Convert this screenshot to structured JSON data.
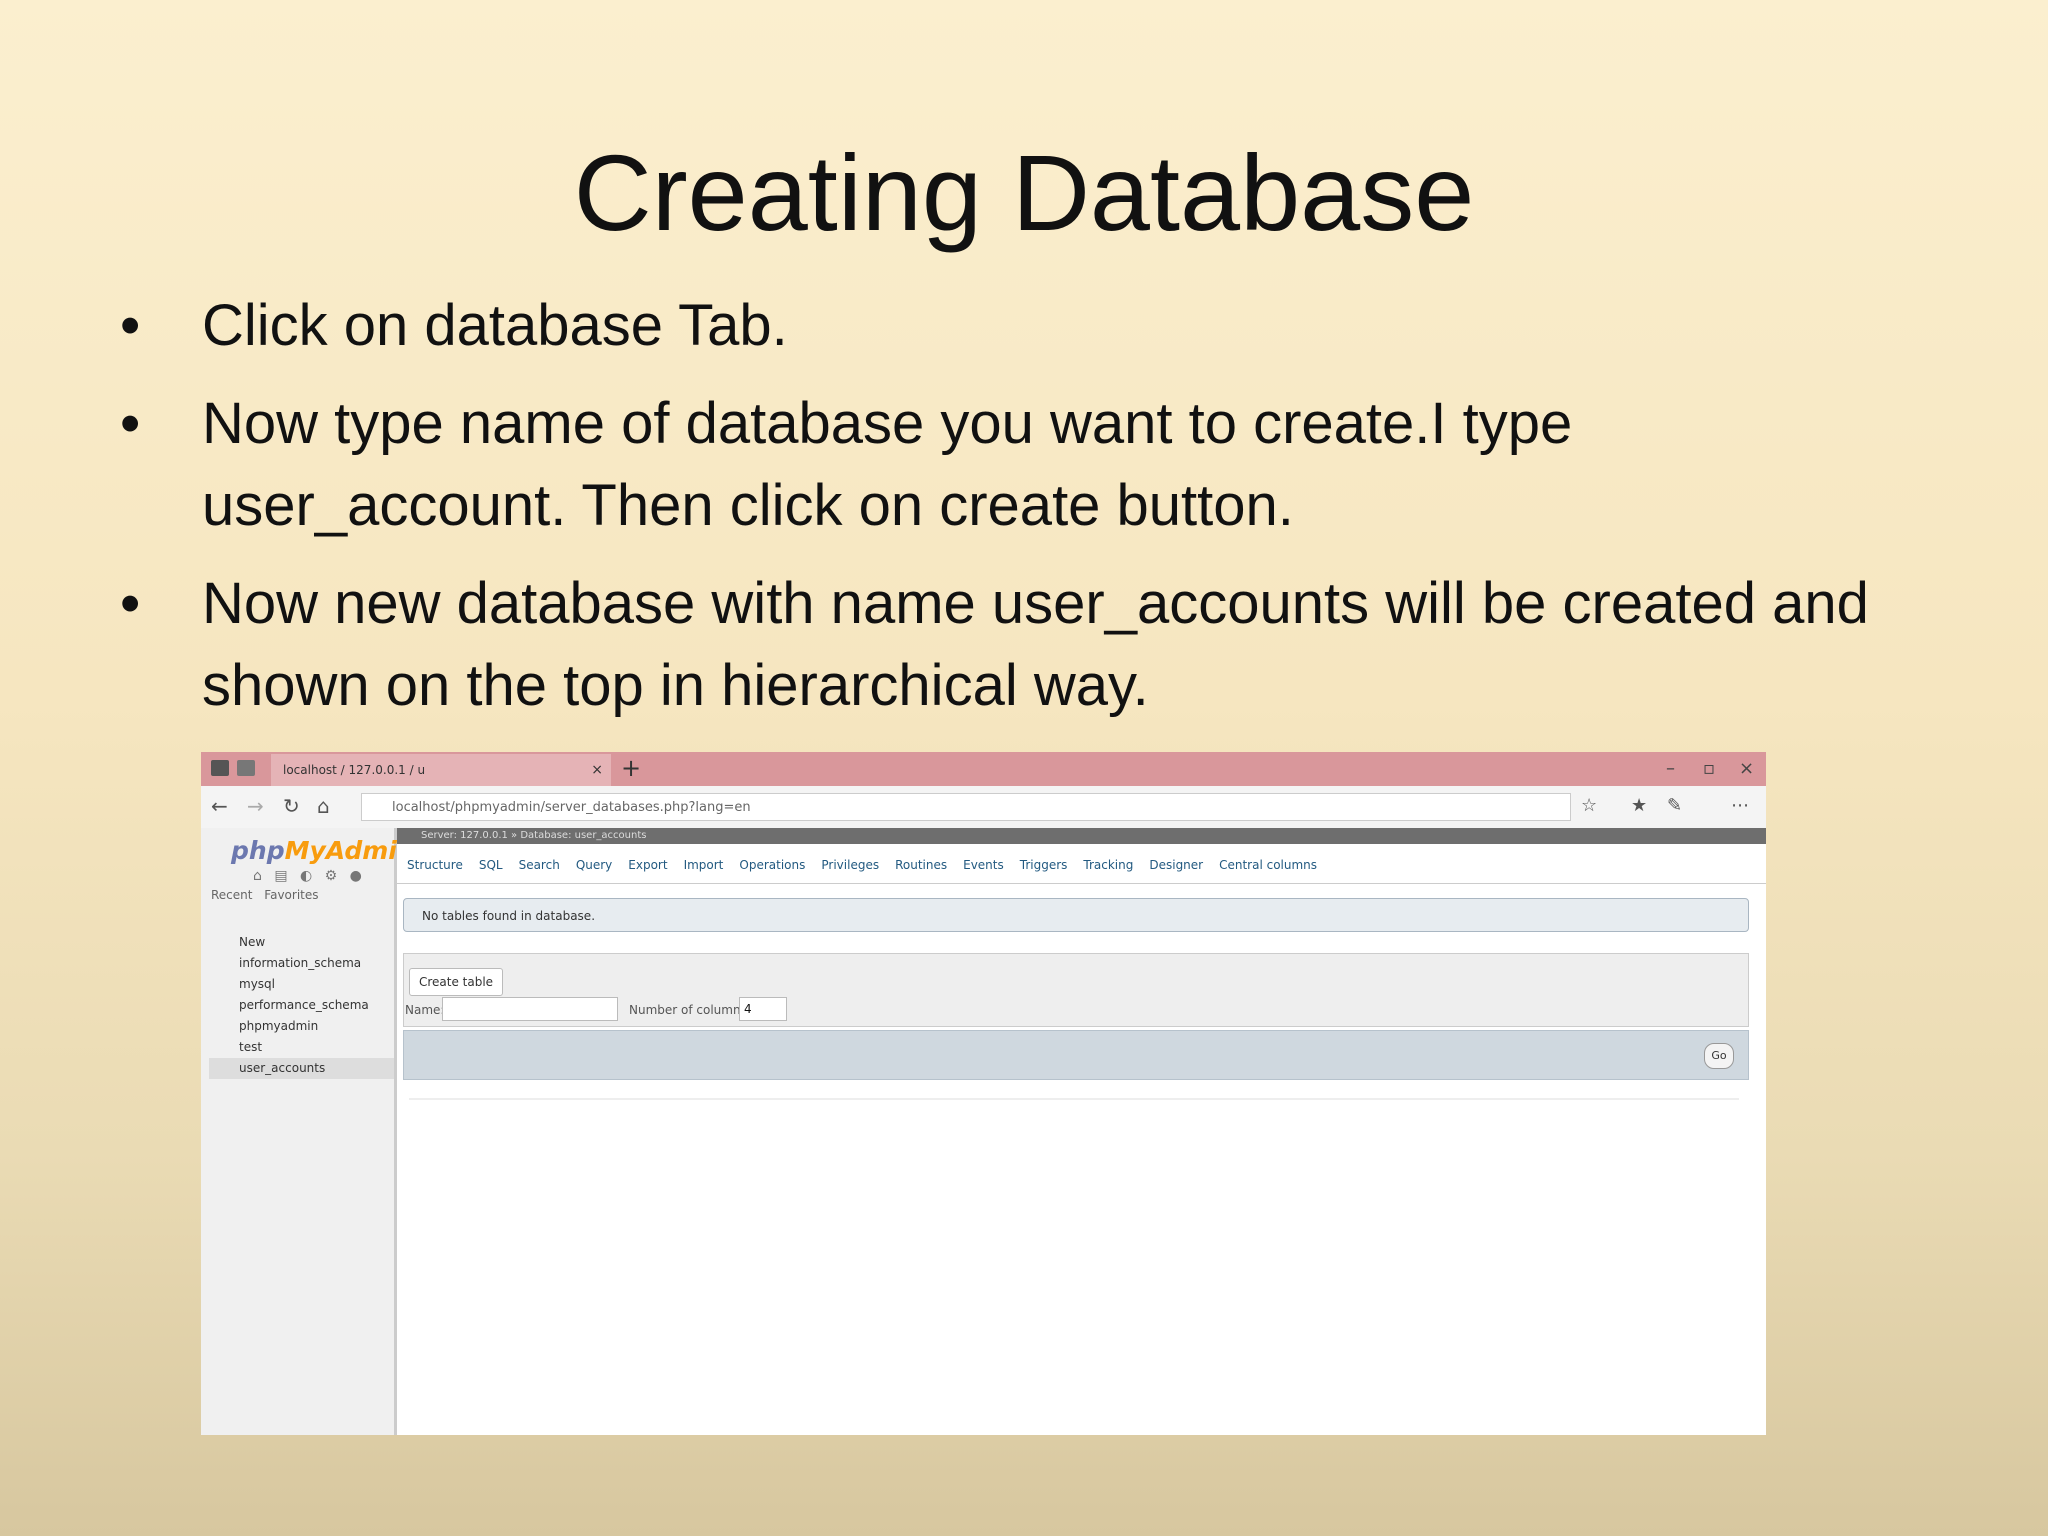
{
  "slide": {
    "title": "Creating Database",
    "bullet_glyph": "•",
    "bullets": [
      "Click on database Tab.",
      "Now type name of database you want to create.I type user_account. Then click on create button.",
      "Now new database with name user_accounts will be created and shown on the top in hierarchical way."
    ]
  },
  "screenshot": {
    "browser_tab_title": "localhost / 127.0.0.1 / u",
    "tab_close": "×",
    "new_tab": "+",
    "window_controls": [
      "–",
      "▫",
      "×"
    ],
    "nav_icons": [
      "←",
      "→",
      "↻",
      "⌂"
    ],
    "url": "localhost/phpmyadmin/server_databases.php?lang=en",
    "toolbar_icons": [
      "☆",
      "★",
      "✎",
      "⋯"
    ],
    "logo_php": "php",
    "logo_myadmin": "MyAdmin",
    "left_icons": "⌂ ▤ ◐ ⚙ ●",
    "left_tabs": "Recent Favorites",
    "tree": [
      "New",
      "information_schema",
      "mysql",
      "performance_schema",
      "phpmyadmin",
      "test",
      "user_accounts"
    ],
    "breadcrumb": "Server: 127.0.0.1 » Database: user_accounts",
    "db_tabs": [
      "Structure",
      "SQL",
      "Search",
      "Query",
      "Export",
      "Import",
      "Operations",
      "Privileges",
      "Routines",
      "Events",
      "Triggers",
      "Tracking",
      "Designer",
      "Central columns"
    ],
    "notice": "No tables found in database.",
    "create_table": "Create table",
    "name_label": "Name:",
    "columns_label": "Number of columns:",
    "columns_value": "4",
    "go": "Go"
  }
}
